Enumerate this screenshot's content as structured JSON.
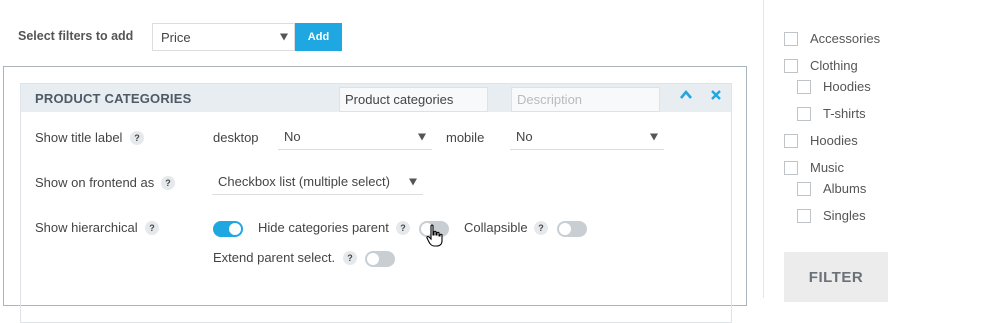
{
  "filter_bar": {
    "label": "Select filters to add",
    "selected": "Price",
    "add_label": "Add"
  },
  "panel": {
    "title": "PRODUCT CATEGORIES",
    "name_value": "Product categories",
    "description_placeholder": "Description",
    "rows": {
      "title_label": {
        "label": "Show title label",
        "help": "?",
        "desktop_label": "desktop",
        "desktop_value": "No",
        "mobile_label": "mobile",
        "mobile_value": "No"
      },
      "frontend": {
        "label": "Show on frontend as",
        "help": "?",
        "value": "Checkbox list (multiple select)"
      },
      "hierarchical": {
        "label": "Show hierarchical",
        "help": "?",
        "toggle_on": true,
        "hide_parent_label": "Hide categories parent",
        "hide_parent_on": false,
        "collapsible_label": "Collapsible",
        "collapsible_on": false,
        "extend_label": "Extend parent select.",
        "extend_on": false
      }
    }
  },
  "sidebar": {
    "items": [
      {
        "label": "Accessories",
        "level": 0
      },
      {
        "label": "Clothing",
        "level": 0
      },
      {
        "label": "Hoodies",
        "level": 1
      },
      {
        "label": "T-shirts",
        "level": 1
      },
      {
        "label": "Hoodies",
        "level": 0
      },
      {
        "label": "Music",
        "level": 0
      },
      {
        "label": "Albums",
        "level": 1
      },
      {
        "label": "Singles",
        "level": 1
      }
    ],
    "filter_label": "FILTER"
  },
  "colors": {
    "accent": "#1ea7e1",
    "panel_header": "#e8edf1"
  }
}
